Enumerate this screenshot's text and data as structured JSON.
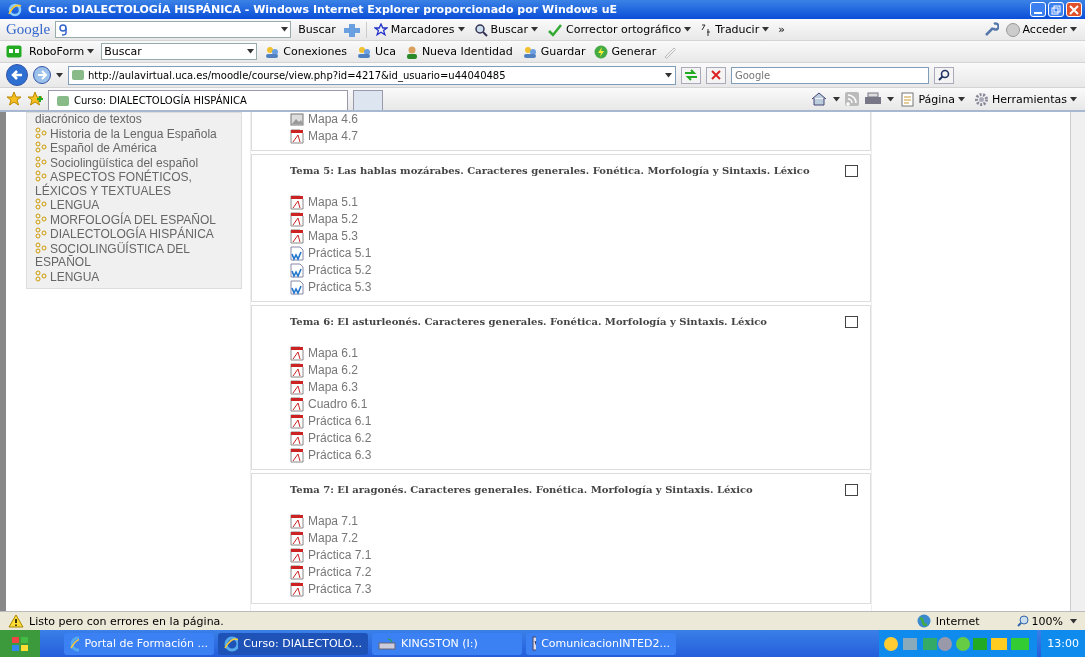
{
  "window": {
    "title": "Curso: DIALECTOLOGÍA HISPÁNICA - Windows Internet Explorer proporcionado por Windows uE"
  },
  "google_toolbar": {
    "logo": "Google",
    "search_button": "Buscar",
    "items": [
      {
        "label": "Marcadores",
        "kind": "star"
      },
      {
        "label": "Buscar",
        "kind": "search"
      },
      {
        "label": "Corrector ortográfico",
        "kind": "check"
      },
      {
        "label": "Traducir",
        "kind": "translate"
      }
    ],
    "more": "»",
    "signin": "Acceder"
  },
  "roboform_toolbar": {
    "label": "RoboForm",
    "search_value": "Buscar",
    "items": [
      {
        "label": "Conexiones",
        "kind": "people"
      },
      {
        "label": "Uca",
        "kind": "people"
      },
      {
        "label": "Nueva Identidad",
        "kind": "person"
      },
      {
        "label": "Guardar",
        "kind": "people"
      },
      {
        "label": "Generar",
        "kind": "bolt"
      }
    ]
  },
  "address_bar": {
    "url": "http://aulavirtual.uca.es/moodle/course/view.php?id=4217&id_usuario=u44040485",
    "search_placeholder": "Google"
  },
  "tabs": [
    {
      "label": "Curso: DIALECTOLOGÍA HISPÁNICA",
      "selected": true
    }
  ],
  "command_bar": [
    {
      "label": "Página",
      "kind": "page"
    },
    {
      "label": "Herramientas",
      "kind": "gear"
    }
  ],
  "sidebar": {
    "items": [
      {
        "label": "diacrónico de textos",
        "kind": "text"
      },
      {
        "label": "Historia de la Lengua Española",
        "kind": "course"
      },
      {
        "label": "Español de América",
        "kind": "course"
      },
      {
        "label": "Sociolingüística del español",
        "kind": "course"
      },
      {
        "label": "ASPECTOS FONÉTICOS, LÉXICOS Y TEXTUALES",
        "kind": "course"
      },
      {
        "label": "LENGUA",
        "kind": "course"
      },
      {
        "label": "MORFOLOGÍA DEL ESPAÑOL",
        "kind": "course"
      },
      {
        "label": "DIALECTOLOGÍA HISPÁNICA",
        "kind": "course"
      },
      {
        "label": "SOCIOLINGÜÍSTICA DEL ESPAÑOL",
        "kind": "course"
      },
      {
        "label": "LENGUA",
        "kind": "course"
      }
    ]
  },
  "sections": [
    {
      "resources": [
        {
          "label": "Mapa 4.6",
          "kind": "image"
        },
        {
          "label": "Mapa 4.7",
          "kind": "pdf"
        }
      ]
    },
    {
      "title": "Tema 5: Las hablas mozárabes. Caracteres generales. Fonética. Morfología y Sintaxis. Léxico",
      "checked": false,
      "resources": [
        {
          "label": "Mapa 5.1",
          "kind": "pdf"
        },
        {
          "label": "Mapa 5.2",
          "kind": "pdf"
        },
        {
          "label": "Mapa 5.3",
          "kind": "pdf"
        },
        {
          "label": "Práctica 5.1",
          "kind": "word"
        },
        {
          "label": "Práctica 5.2",
          "kind": "word"
        },
        {
          "label": "Práctica 5.3",
          "kind": "word"
        }
      ]
    },
    {
      "title": "Tema 6: El asturleonés. Caracteres generales. Fonética. Morfología y Sintaxis. Léxico",
      "checked": false,
      "resources": [
        {
          "label": "Mapa 6.1",
          "kind": "pdf"
        },
        {
          "label": "Mapa 6.2",
          "kind": "pdf"
        },
        {
          "label": "Mapa 6.3",
          "kind": "pdf"
        },
        {
          "label": "Cuadro 6.1",
          "kind": "pdf"
        },
        {
          "label": "Práctica 6.1",
          "kind": "pdf"
        },
        {
          "label": "Práctica 6.2",
          "kind": "pdf"
        },
        {
          "label": "Práctica 6.3",
          "kind": "pdf"
        }
      ]
    },
    {
      "title": "Tema 7: El aragonés. Caracteres generales. Fonética. Morfología y Sintaxis. Léxico",
      "checked": false,
      "resources": [
        {
          "label": "Mapa 7.1",
          "kind": "pdf"
        },
        {
          "label": "Mapa 7.2",
          "kind": "pdf"
        },
        {
          "label": "Práctica 7.1",
          "kind": "pdf"
        },
        {
          "label": "Práctica 7.2",
          "kind": "pdf"
        },
        {
          "label": "Práctica 7.3",
          "kind": "pdf"
        }
      ]
    }
  ],
  "status_bar": {
    "message": "Listo pero con errores en la página.",
    "zone": "Internet",
    "zoom": "100%"
  },
  "taskbar": {
    "tasks": [
      {
        "label": "Portal de Formación ...",
        "kind": "ie",
        "selected": false
      },
      {
        "label": "Curso: DIALECTOLO...",
        "kind": "ie",
        "selected": true
      },
      {
        "label": "KINGSTON (I:)",
        "kind": "drive",
        "selected": false
      },
      {
        "label": "ComunicacionINTED2...",
        "kind": "word",
        "selected": false
      }
    ],
    "clock": "13:00"
  }
}
